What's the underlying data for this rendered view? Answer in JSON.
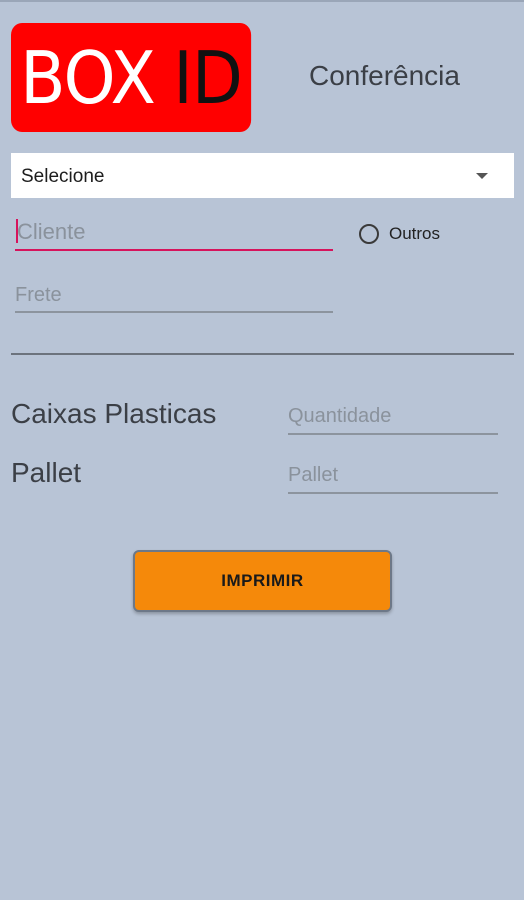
{
  "header": {
    "logo": {
      "word1": "BOX",
      "word2": "ID",
      "background": "#ff0000"
    },
    "title": "Conferência"
  },
  "selector": {
    "value": "Selecione",
    "icon": "dropdown-arrow-icon"
  },
  "form": {
    "cliente": {
      "placeholder": "Cliente",
      "value": ""
    },
    "outros": {
      "label": "Outros",
      "checked": false
    },
    "frete": {
      "placeholder": "Frete",
      "value": ""
    },
    "caixas": {
      "label": "Caixas Plasticas",
      "placeholder": "Quantidade",
      "value": ""
    },
    "pallet": {
      "label": "Pallet",
      "placeholder": "Pallet",
      "value": ""
    }
  },
  "actions": {
    "print_label": "IMPRIMIR",
    "print_color": "#f5890a"
  },
  "colors": {
    "background": "#b8c4d6",
    "focus_accent": "#d6135c"
  }
}
